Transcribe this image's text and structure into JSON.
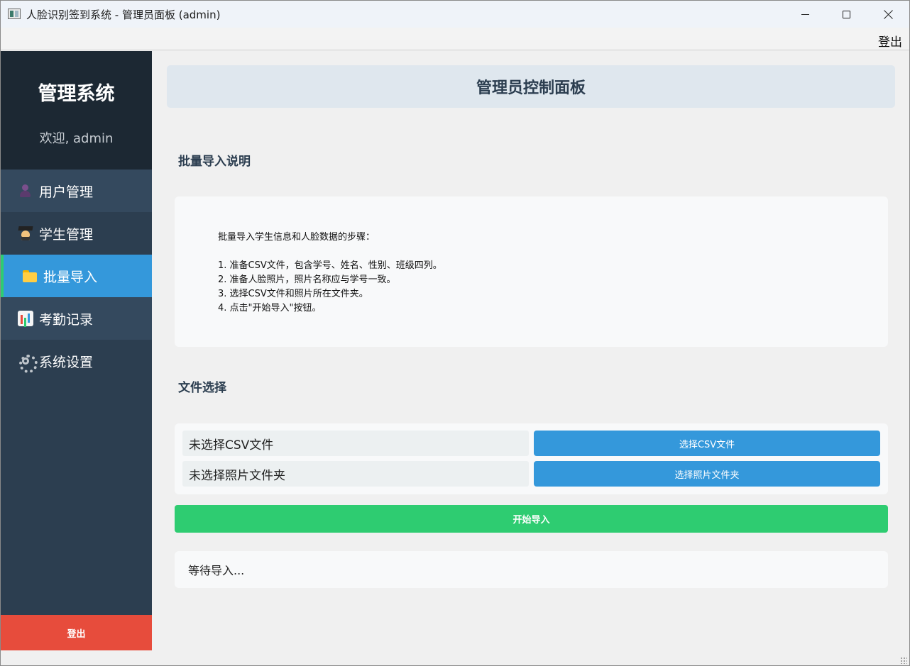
{
  "window": {
    "title": "人脸识别签到系统 - 管理员面板 (admin)"
  },
  "menubar": {
    "logout_label": "登出"
  },
  "sidebar": {
    "title": "管理系统",
    "welcome": "欢迎, admin",
    "items": [
      {
        "label": "用户管理",
        "icon": "user-icon"
      },
      {
        "label": "学生管理",
        "icon": "student-icon"
      },
      {
        "label": "批量导入",
        "icon": "folder-icon",
        "active": true
      },
      {
        "label": "考勤记录",
        "icon": "chart-icon"
      },
      {
        "label": "系统设置",
        "icon": "gear-icon"
      }
    ],
    "logout_label": "登出"
  },
  "main": {
    "header_title": "管理员控制面板",
    "instructions_title": "批量导入说明",
    "instructions": [
      "批量导入学生信息和人脸数据的步骤：",
      "",
      "1. 准备CSV文件，包含学号、姓名、性别、班级四列。",
      "2. 准备人脸照片，照片名称应与学号一致。",
      "3. 选择CSV文件和照片所在文件夹。",
      "4. 点击\"开始导入\"按钮。"
    ],
    "file_section_title": "文件选择",
    "csv_status": "未选择CSV文件",
    "csv_button": "选择CSV文件",
    "photo_status": "未选择照片文件夹",
    "photo_button": "选择照片文件夹",
    "start_button": "开始导入",
    "import_status": "等待导入..."
  },
  "colors": {
    "sidebar_bg": "#2c3e50",
    "sidebar_header_bg": "#1c2833",
    "active_item": "#3498db",
    "accent_green": "#2ecc71",
    "logout_red": "#e74c3c"
  }
}
